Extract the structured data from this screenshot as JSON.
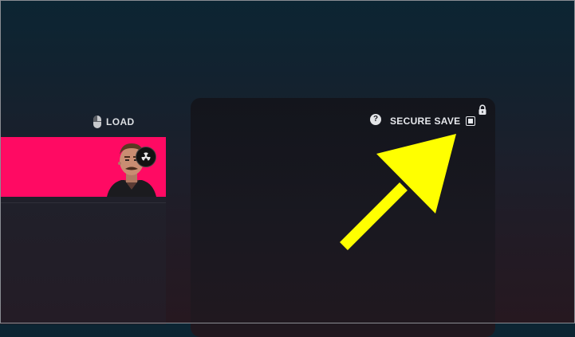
{
  "load": {
    "label": "LOAD",
    "icon": "mouse-left-click-icon"
  },
  "save_slot": {
    "accent_color": "#ff0a63",
    "portrait": "character-portrait",
    "badge_icon": "radiation-icon"
  },
  "details": {
    "secure_save_label": "SECURE SAVE",
    "secure_save_checked": true,
    "help_icon": "question-mark-icon",
    "help_glyph": "?",
    "lock_icon": "lock-icon"
  },
  "annotation": {
    "type": "arrow",
    "color": "#ffff00",
    "points_to": "secure-save-checkbox"
  }
}
